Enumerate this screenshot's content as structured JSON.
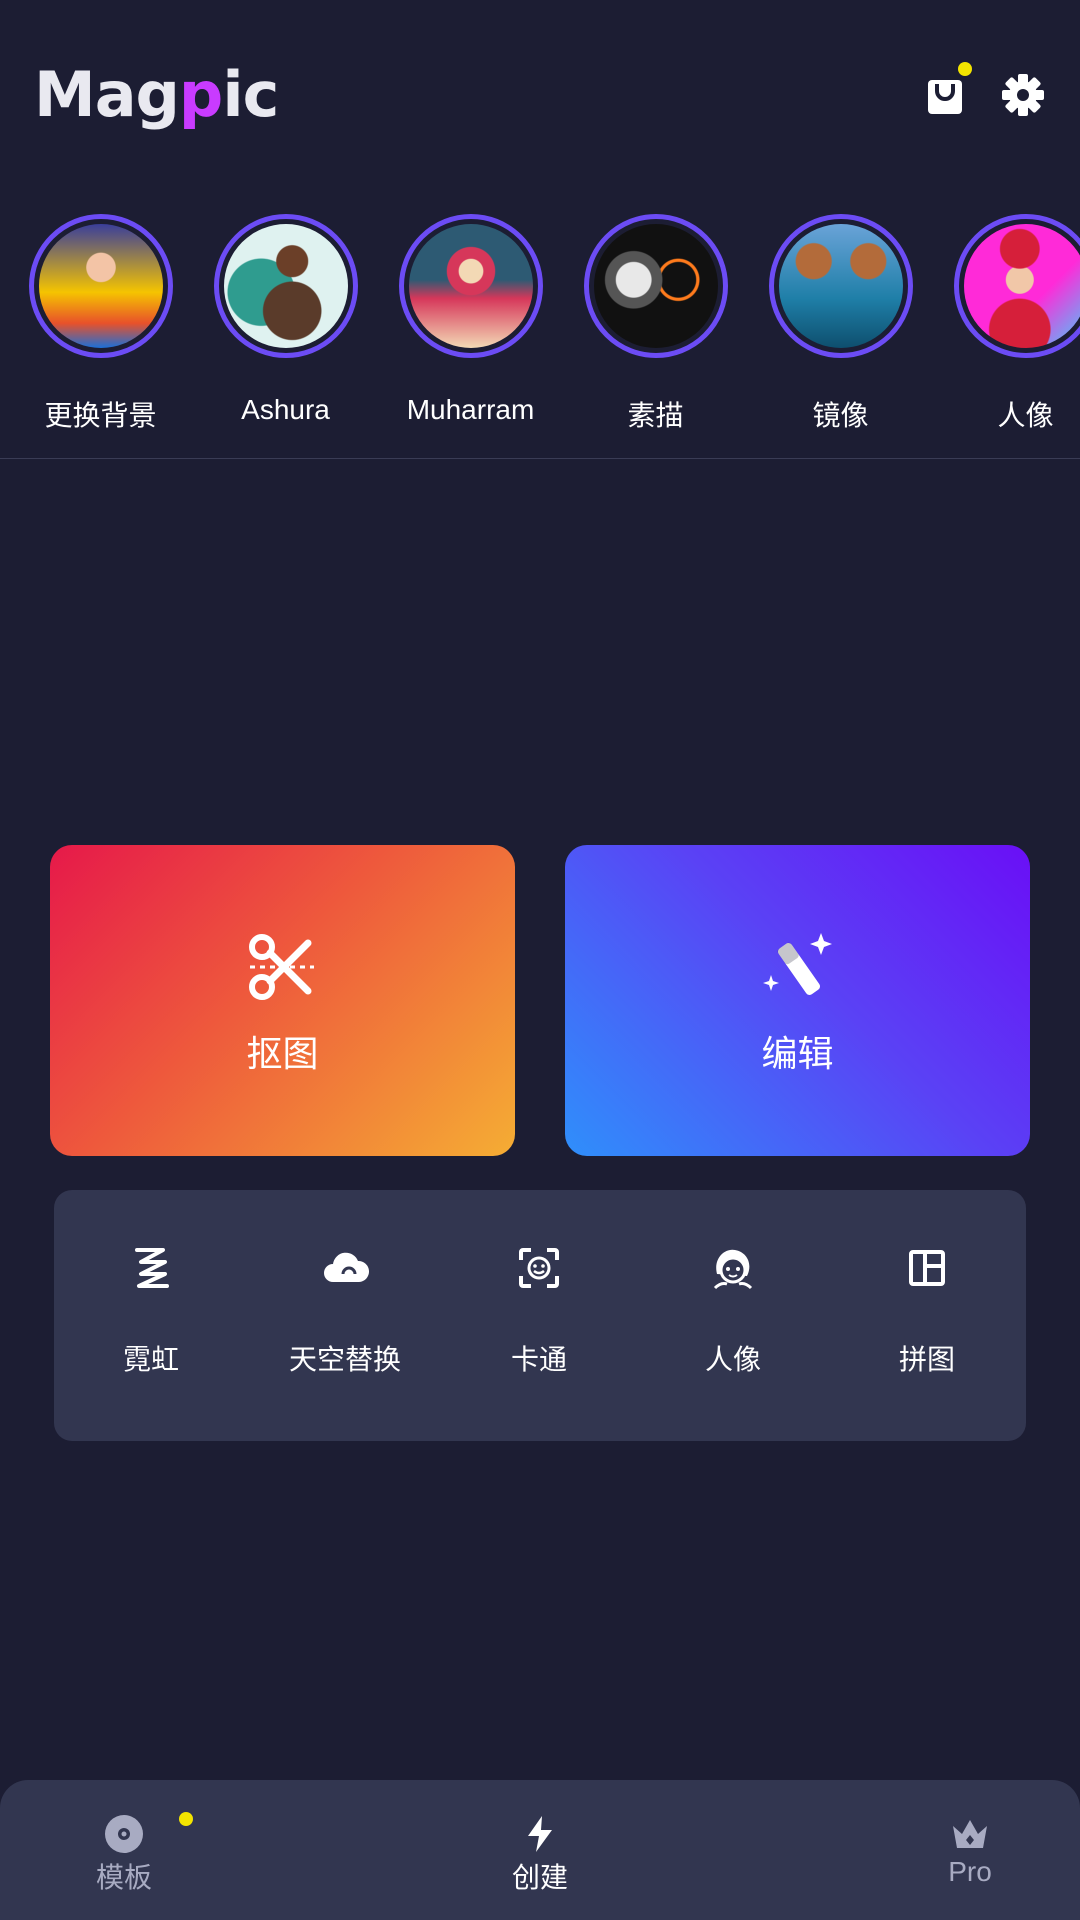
{
  "header": {
    "logo_text": "Magpic",
    "cart_icon": "shopping-bag-icon",
    "settings_icon": "gear-icon",
    "notification_dot_color": "#f3e400"
  },
  "stories": [
    {
      "label": "更换背景",
      "thumb_colors": [
        "#f5c400",
        "#e8512a",
        "#1b6fd8"
      ]
    },
    {
      "label": "Ashura",
      "thumb_colors": [
        "#dff2f0",
        "#2f9c8f",
        "#5a3b2a"
      ]
    },
    {
      "label": "Muharram",
      "thumb_colors": [
        "#2d5a73",
        "#d6375a",
        "#f3d9b5"
      ]
    },
    {
      "label": "素描",
      "thumb_colors": [
        "#e8e8e8",
        "#111111",
        "#ff7b1c"
      ]
    },
    {
      "label": "镜像",
      "thumb_colors": [
        "#6aa3d8",
        "#1f7fa8",
        "#b36b3a"
      ]
    },
    {
      "label": "人像",
      "thumb_colors": [
        "#ff2ad8",
        "#d61f3a",
        "#3ad6ff"
      ]
    }
  ],
  "main_actions": [
    {
      "label": "抠图",
      "icon": "scissors-icon"
    },
    {
      "label": "编辑",
      "icon": "magic-wand-icon"
    }
  ],
  "tools": [
    {
      "label": "霓虹",
      "icon": "neon-zigzag-icon"
    },
    {
      "label": "天空替换",
      "icon": "cloud-icon"
    },
    {
      "label": "卡通",
      "icon": "face-scan-icon"
    },
    {
      "label": "人像",
      "icon": "portrait-face-icon"
    },
    {
      "label": "拼图",
      "icon": "collage-grid-icon"
    }
  ],
  "bottom_nav": [
    {
      "label": "模板",
      "icon": "template-disc-icon",
      "active": false,
      "has_dot": true
    },
    {
      "label": "创建",
      "icon": "lightning-icon",
      "active": true,
      "has_dot": false
    },
    {
      "label": "Pro",
      "icon": "crown-icon",
      "active": false,
      "has_dot": false
    }
  ],
  "colors": {
    "background": "#1c1d33",
    "panel": "#323650",
    "accent_ring": "#6c4cf5",
    "nav_active": "#ffffff",
    "nav_inactive": "#a8abc2"
  }
}
